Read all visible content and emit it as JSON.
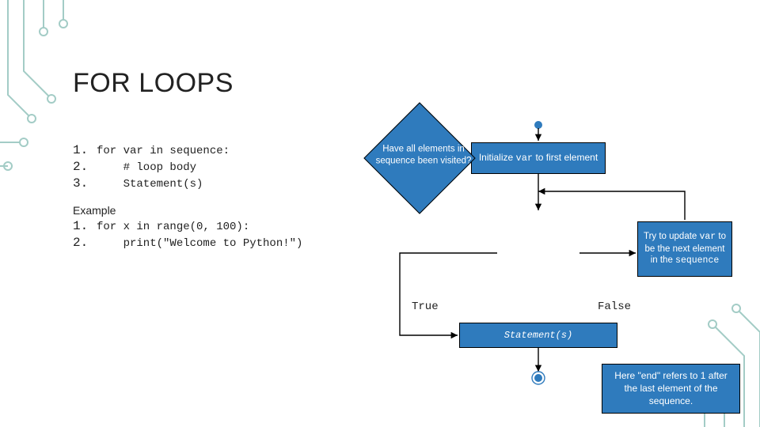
{
  "title": "FOR LOOPS",
  "syntax": {
    "lines": [
      {
        "n": "1.",
        "text": "for var in sequence:"
      },
      {
        "n": "2.",
        "text": "    # loop body"
      },
      {
        "n": "3.",
        "text": "    Statement(s)"
      }
    ]
  },
  "example": {
    "label": "Example",
    "lines": [
      {
        "n": "1.",
        "text": "for x in range(0, 100):"
      },
      {
        "n": "2.",
        "text": "    print(\"Welcome to Python!\")"
      }
    ]
  },
  "flow": {
    "init_a": "Initialize ",
    "init_var": "var",
    "init_b": " to first element",
    "diamond_a": "Have all elements in ",
    "diamond_seq": "sequence",
    "diamond_b": " been visited?",
    "side_a": "Try to update ",
    "side_var": "var",
    "side_b": " to be the next element in the ",
    "side_seq": "sequence",
    "stmt": "Statement(s)",
    "true": "True",
    "false": "False",
    "note": "Here \"end\" refers to 1 after the last element of the sequence."
  }
}
